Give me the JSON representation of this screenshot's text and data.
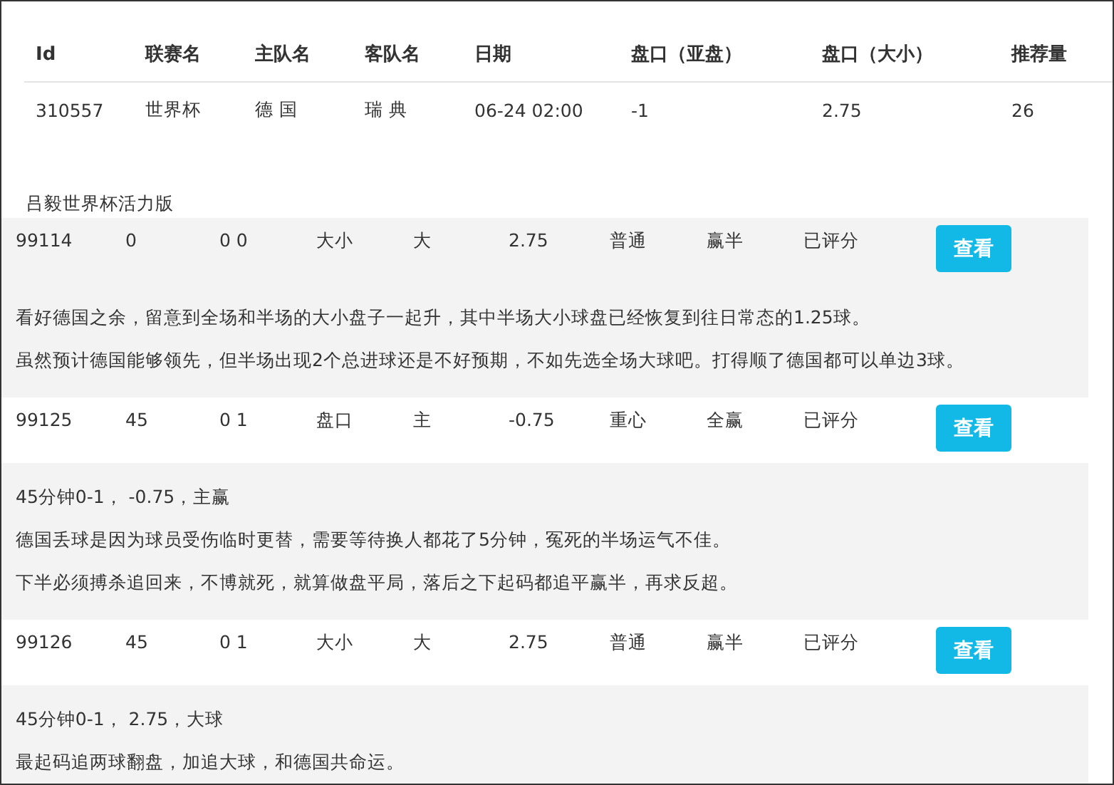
{
  "match_table": {
    "columns": [
      "Id",
      "联赛名",
      "主队名",
      "客队名",
      "日期",
      "盘口（亚盘）",
      "盘口（大小）",
      "推荐量"
    ],
    "rows": [
      [
        "310557",
        "世界杯",
        "德 国",
        "瑞 典",
        "06-24 02:00",
        "-1",
        "2.75",
        "26"
      ]
    ]
  },
  "section_title": "吕毅世界杯活力版",
  "records": [
    {
      "highlighted": true,
      "cells": [
        "99114",
        "0",
        "0 0",
        "大小",
        "大",
        "2.75",
        "普通",
        "赢半",
        "已评分"
      ],
      "button": "查看",
      "comments": [
        "看好德国之余，留意到全场和半场的大小盘子一起升，其中半场大小球盘已经恢复到往日常态的1.25球。",
        "虽然预计德国能够领先，但半场出现2个总进球还是不好预期，不如先选全场大球吧。打得顺了德国都可以单边3球。"
      ]
    },
    {
      "highlighted": false,
      "cells": [
        "99125",
        "45",
        "0 1",
        "盘口",
        "主",
        "-0.75",
        "重心",
        "全赢",
        "已评分"
      ],
      "button": "查看",
      "comments": [
        "45分钟0-1， -0.75，主赢",
        "德国丢球是因为球员受伤临时更替，需要等待换人都花了5分钟，冤死的半场运气不佳。",
        "下半必须搏杀追回来，不博就死，就算做盘平局，落后之下起码都追平赢半，再求反超。"
      ]
    },
    {
      "highlighted": false,
      "cells": [
        "99126",
        "45",
        "0 1",
        "大小",
        "大",
        "2.75",
        "普通",
        "赢半",
        "已评分"
      ],
      "button": "查看",
      "comments": [
        "45分钟0-1， 2.75，大球",
        "最起码追两球翻盘，加追大球，和德国共命运。"
      ]
    }
  ]
}
